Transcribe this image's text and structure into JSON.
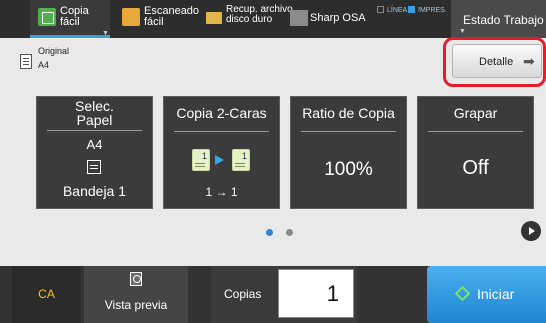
{
  "tabs": {
    "copia": "Copia fácil",
    "escaneado": "Escaneado fácil",
    "recup": "Recup. archivo disco duro",
    "osa": "Sharp OSA",
    "status_line": "LÍNEA",
    "status_impres": "IMPRES.",
    "estado": "Estado Trabajo"
  },
  "original": {
    "label": "Original",
    "size": "A4"
  },
  "detail_button": "Detalle",
  "tiles": {
    "paper": {
      "title": "Selec. Papel",
      "size": "A4",
      "tray": "Bandeja 1"
    },
    "duplex": {
      "title": "Copia 2-Caras",
      "value": "1 → 1",
      "page_num": "1"
    },
    "ratio": {
      "title": "Ratio de Copia",
      "value": "100%"
    },
    "staple": {
      "title": "Grapar",
      "value": "Off"
    }
  },
  "pager": {
    "pages": 2,
    "current": 1
  },
  "bottom": {
    "ca": "CA",
    "preview": "Vista previa",
    "copies_label": "Copias",
    "copies_value": "1",
    "start": "Iniciar"
  },
  "colors": {
    "accent_blue": "#2e86d1",
    "highlight_red": "#e41d2a",
    "ca_yellow": "#f4c22e"
  }
}
